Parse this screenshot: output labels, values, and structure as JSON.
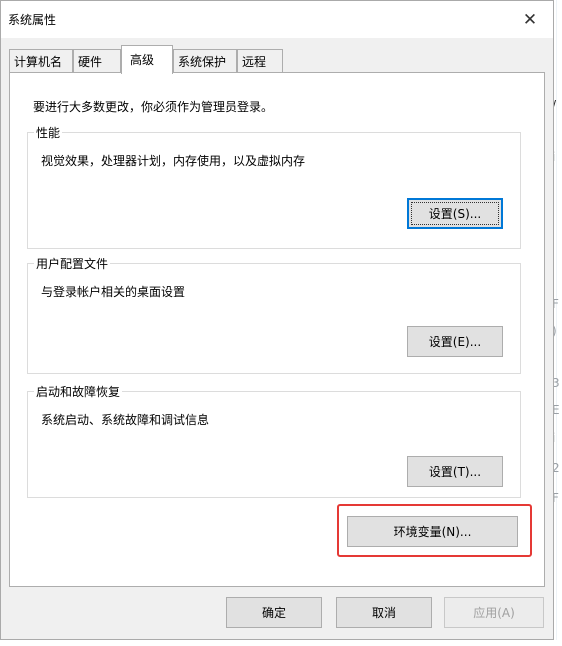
{
  "window": {
    "title": "系统属性",
    "close_glyph": "✕"
  },
  "tabs": [
    {
      "label": "计算机名",
      "active": false
    },
    {
      "label": "硬件",
      "active": false
    },
    {
      "label": "高级",
      "active": true
    },
    {
      "label": "系统保护",
      "active": false
    },
    {
      "label": "远程",
      "active": false
    }
  ],
  "advanced": {
    "notice": "要进行大多数更改，你必须作为管理员登录。",
    "performance": {
      "title": "性能",
      "description": "视觉效果，处理器计划，内存使用，以及虚拟内存",
      "button": "设置(S)..."
    },
    "user_profiles": {
      "title": "用户配置文件",
      "description": "与登录帐户相关的桌面设置",
      "button": "设置(E)..."
    },
    "startup_recovery": {
      "title": "启动和故障恢复",
      "description": "系统启动、系统故障和调试信息",
      "button": "设置(T)..."
    },
    "env_button": "环境变量(N)...",
    "highlight_color": "#e53935"
  },
  "footer": {
    "ok": "确定",
    "cancel": "取消",
    "apply": "应用(A)"
  },
  "background_fragments": [
    "/",
    "i",
    "F",
    ")",
    "3",
    "E",
    "i",
    "2",
    "F"
  ]
}
